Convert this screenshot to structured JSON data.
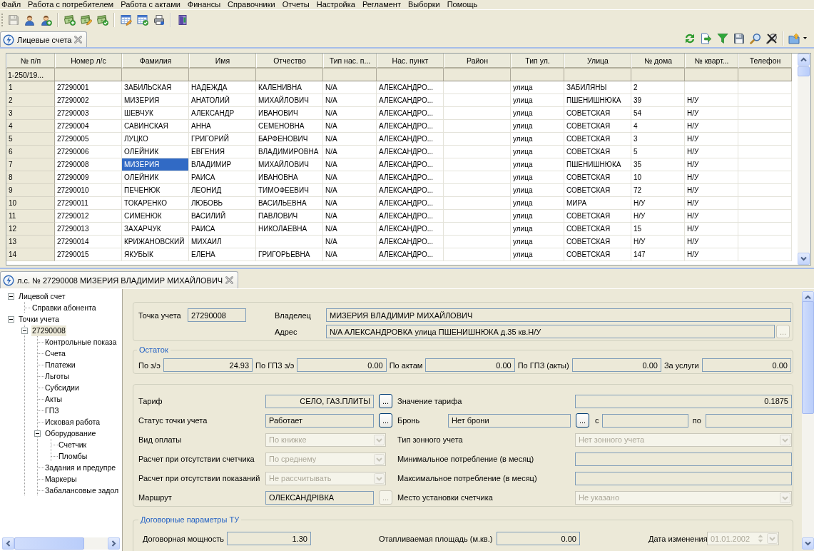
{
  "menu": [
    "Файл",
    "Работа с потребителем",
    "Работа с актами",
    "Финансы",
    "Справочники",
    "Отчеты",
    "Настройка",
    "Регламент",
    "Выборки",
    "Помощь"
  ],
  "toolbar": [
    {
      "disabled": true
    },
    {
      "disabled": false
    },
    {
      "disabled": false
    },
    {
      "disabled": false
    },
    {
      "disabled": false
    },
    {
      "disabled": false
    },
    {
      "disabled": false
    },
    {
      "disabled": false
    },
    {
      "disabled": false
    },
    {
      "disabled": false
    }
  ],
  "tabs": [
    {
      "label": "Лицевые счета",
      "selected": true
    }
  ],
  "table": {
    "columns": [
      {
        "label": "№ п/п",
        "selected": false
      },
      {
        "label": "Номер л/с",
        "selected": false
      },
      {
        "label": "Фамилия",
        "selected": true
      },
      {
        "label": "Имя",
        "selected": false
      },
      {
        "label": "Отчество",
        "selected": false
      },
      {
        "label": "Тип нас. п...",
        "selected": false
      },
      {
        "label": "Нас. пункт",
        "selected": false
      },
      {
        "label": "Район",
        "selected": false
      },
      {
        "label": "Тип ул.",
        "selected": false
      },
      {
        "label": "Улица",
        "selected": false
      },
      {
        "label": "№ дома",
        "selected": false
      },
      {
        "label": "№ кварт...",
        "selected": false
      },
      {
        "label": "Телефон",
        "selected": false
      }
    ],
    "counter": "1-250/19...",
    "rows": [
      {
        "n": "1",
        "account": "27290001",
        "surname": "ЗАБИЛЬСКАЯ",
        "name": "НАДЕЖДА",
        "patronymic": "КАЛЕНИВНА",
        "settlement_type": "N/A",
        "settlement": "АЛЕКСАНДРО...",
        "street_type": "улица",
        "street": "ЗАБИЛЯНЫ",
        "house": "2",
        "selected": false
      },
      {
        "n": "2",
        "account": "27290002",
        "surname": "МИЗЕРИЯ",
        "name": "АНАТОЛИЙ",
        "patronymic": "МИХАЙЛОВИЧ",
        "settlement_type": "N/A",
        "settlement": "АЛЕКСАНДРО...",
        "street_type": "улица",
        "street": "ПШЕНИШНЮКА",
        "house": "39",
        "flat": "Н/У",
        "selected": false
      },
      {
        "n": "3",
        "account": "27290003",
        "surname": "ШЕВЧУК",
        "name": "АЛЕКСАНДР",
        "patronymic": "ИВАНОВИЧ",
        "settlement_type": "N/A",
        "settlement": "АЛЕКСАНДРО...",
        "street_type": "улица",
        "street": "СОВЕТСКАЯ",
        "house": "54",
        "flat": "Н/У",
        "selected": false
      },
      {
        "n": "4",
        "account": "27290004",
        "surname": "САВИНСКАЯ",
        "name": "АННА",
        "patronymic": "СЕМЕНОВНА",
        "settlement_type": "N/A",
        "settlement": "АЛЕКСАНДРО...",
        "street_type": "улица",
        "street": "СОВЕТСКАЯ",
        "house": "4",
        "flat": "Н/У",
        "selected": false
      },
      {
        "n": "5",
        "account": "27290005",
        "surname": "ЛУЦКО",
        "name": "ГРИГОРИЙ",
        "patronymic": "БАРФЕНОВИЧ",
        "settlement_type": "N/A",
        "settlement": "АЛЕКСАНДРО...",
        "street_type": "улица",
        "street": "СОВЕТСКАЯ",
        "house": "3",
        "flat": "Н/У",
        "selected": false
      },
      {
        "n": "6",
        "account": "27290006",
        "surname": "ОЛЕЙНИК",
        "name": "ЕВГЕНИЯ",
        "patronymic": "ВЛАДИМИРОВНА",
        "settlement_type": "N/A",
        "settlement": "АЛЕКСАНДРО...",
        "street_type": "улица",
        "street": "СОВЕТСКАЯ",
        "house": "5",
        "flat": "Н/У",
        "selected": false
      },
      {
        "n": "7",
        "account": "27290008",
        "surname": "МИЗЕРИЯ",
        "name": "ВЛАДИМИР",
        "patronymic": "МИХАЙЛОВИЧ",
        "settlement_type": "N/A",
        "settlement": "АЛЕКСАНДРО...",
        "street_type": "улица",
        "street": "ПШЕНИШНЮКА",
        "house": "35",
        "flat": "Н/У",
        "selected": true
      },
      {
        "n": "8",
        "account": "27290009",
        "surname": "ОЛЕЙНИК",
        "name": "РАИСА",
        "patronymic": "ИВАНОВНА",
        "settlement_type": "N/A",
        "settlement": "АЛЕКСАНДРО...",
        "street_type": "улица",
        "street": "СОВЕТСКАЯ",
        "house": "10",
        "flat": "Н/У",
        "selected": false
      },
      {
        "n": "9",
        "account": "27290010",
        "surname": "ПЕЧЕНЮК",
        "name": "ЛЕОНИД",
        "patronymic": "ТИМОФЕЕВИЧ",
        "settlement_type": "N/A",
        "settlement": "АЛЕКСАНДРО...",
        "street_type": "улица",
        "street": "СОВЕТСКАЯ",
        "house": "72",
        "flat": "Н/У",
        "selected": false
      },
      {
        "n": "10",
        "account": "27290011",
        "surname": "ТОКАРЕНКО",
        "name": "ЛЮБОВЬ",
        "patronymic": "ВАСИЛЬЕВНА",
        "settlement_type": "N/A",
        "settlement": "АЛЕКСАНДРО...",
        "street_type": "улица",
        "street": "МИРА",
        "house": "Н/У",
        "flat": "Н/У",
        "selected": false
      },
      {
        "n": "11",
        "account": "27290012",
        "surname": "СИМЕНЮК",
        "name": "ВАСИЛИЙ",
        "patronymic": "ПАВЛОВИЧ",
        "settlement_type": "N/A",
        "settlement": "АЛЕКСАНДРО...",
        "street_type": "улица",
        "street": "СОВЕТСКАЯ",
        "house": "Н/У",
        "flat": "Н/У",
        "selected": false
      },
      {
        "n": "12",
        "account": "27290013",
        "surname": "ЗАХАРЧУК",
        "name": "РАИСА",
        "patronymic": "НИКОЛАЕВНА",
        "settlement_type": "N/A",
        "settlement": "АЛЕКСАНДРО...",
        "street_type": "улица",
        "street": "СОВЕТСКАЯ",
        "house": "15",
        "flat": "Н/У",
        "selected": false
      },
      {
        "n": "13",
        "account": "27290014",
        "surname": "КРИЖАНОВСКИЙ",
        "name": "МИХАИЛ",
        "settlement_type": "N/A",
        "settlement": "АЛЕКСАНДРО...",
        "street_type": "улица",
        "street": "СОВЕТСКАЯ",
        "house": "Н/У",
        "flat": "Н/У",
        "selected": false
      },
      {
        "n": "14",
        "account": "27290015",
        "surname": "ЯКУБЫК",
        "name": "ЕЛЕНА",
        "patronymic": "ГРИГОРЬЕВНА",
        "settlement_type": "N/A",
        "settlement": "АЛЕКСАНДРО...",
        "street_type": "улица",
        "street": "СОВЕТСКАЯ",
        "house": "147",
        "flat": "Н/У",
        "selected": false
      }
    ]
  },
  "detail": {
    "tabs": [
      {
        "label": "л.с. № 27290008 МИЗЕРИЯ ВЛАДИМИР МИХАЙЛОВИЧ",
        "selected": true
      }
    ],
    "tree": [
      {
        "label": "Лицевой счет",
        "expanded": true,
        "selected": false,
        "children": [
          {
            "label": "Справки абонента",
            "selected": false
          }
        ]
      },
      {
        "label": "Точки учета",
        "expanded": true,
        "selected": false,
        "children": [
          {
            "label": "27290008",
            "expanded": true,
            "selected": true,
            "children": [
              {
                "label": "Контрольные показа",
                "selected": false
              },
              {
                "label": "Счета",
                "selected": false
              },
              {
                "label": "Платежи",
                "selected": false
              },
              {
                "label": "Льготы",
                "selected": false
              },
              {
                "label": "Субсидии",
                "selected": false
              },
              {
                "label": "Акты",
                "selected": false
              },
              {
                "label": "ГПЗ",
                "selected": false
              },
              {
                "label": "Исковая работа",
                "selected": false
              },
              {
                "label": "Оборудование",
                "expanded": true,
                "selected": false,
                "children": [
                  {
                    "label": "Счетчик",
                    "selected": false
                  },
                  {
                    "label": "Пломбы",
                    "selected": false
                  }
                ]
              },
              {
                "label": "Задания и предупре",
                "selected": false
              },
              {
                "label": "Маркеры",
                "selected": false
              },
              {
                "label": "Забалансовые задол",
                "selected": false
              }
            ]
          }
        ]
      }
    ],
    "header": {
      "point_label": "Точка учета",
      "point": "27290008",
      "owner_label": "Владелец",
      "owner": "МИЗЕРИЯ ВЛАДИМИР МИХАЙЛОВИЧ",
      "address_label": "Адрес",
      "address": "N/A АЛЕКСАНДРОВКА улица ПШЕНИШНЮКА д.35 кв.Н/У",
      "address_button": {
        "label": "...",
        "disabled": true
      }
    },
    "balance": {
      "title": "Остаток",
      "items": [
        {
          "label": "По з/э",
          "value": "24.93"
        },
        {
          "label": "По ГПЗ з/э",
          "value": "0.00"
        },
        {
          "label": "По актам",
          "value": "0.00"
        },
        {
          "label": "По ГПЗ (акты)",
          "value": "0.00"
        },
        {
          "label": "За услуги",
          "value": "0.00"
        }
      ]
    },
    "params": [
      {
        "left": {
          "kind": "picker",
          "label": "Тариф",
          "value": "СЕЛО, ГАЗ.ПЛИТЫ",
          "button": {
            "label": "...",
            "disabled": false
          }
        },
        "right": {
          "kind": "number",
          "label": "Значение тарифа",
          "value": "0.1875"
        }
      },
      {
        "left": {
          "kind": "picker",
          "label": "Статус точки учета",
          "value": "Работает",
          "button": {
            "label": "...",
            "disabled": false
          }
        },
        "right": {
          "kind": "reserve",
          "label": "Бронь",
          "value": "Нет брони",
          "button": {
            "label": "...",
            "disabled": false
          },
          "from_label": "с",
          "to_label": "по"
        }
      },
      {
        "left": {
          "kind": "combo",
          "label": "Вид оплаты",
          "value": "По книжке",
          "disabled": true
        },
        "right": {
          "kind": "combo",
          "label": "Тип зонного учета",
          "value": "Нет зонного учета",
          "disabled": true
        }
      },
      {
        "left": {
          "kind": "combo",
          "label": "Расчет при отсутствии счетчика",
          "value": "По среднему",
          "disabled": true
        },
        "right": {
          "kind": "text",
          "label": "Минимальное потребление (в месяц)"
        }
      },
      {
        "left": {
          "kind": "combo",
          "label": "Расчет при отсутствии показаний",
          "value": "Не рассчитывать",
          "disabled": true
        },
        "right": {
          "kind": "text",
          "label": "Максимальное потребление (в месяц)"
        }
      },
      {
        "left": {
          "kind": "picker",
          "label": "Маршрут",
          "value": "ОЛЕКСАНДРІВКА",
          "button": {
            "label": "...",
            "disabled": true
          }
        },
        "right": {
          "kind": "combo",
          "label": "Место установки счетчика",
          "value": "Не указано",
          "disabled": true
        }
      }
    ],
    "contract": {
      "title": "Договорные параметры ТУ",
      "power_label": "Договорная мощность",
      "power": "1.30",
      "area_label": "Отапливаемая площадь (м.кв.)",
      "area": "0.00",
      "date_label": "Дата изменения",
      "date": "01.01.2002",
      "date_disabled": true
    }
  }
}
